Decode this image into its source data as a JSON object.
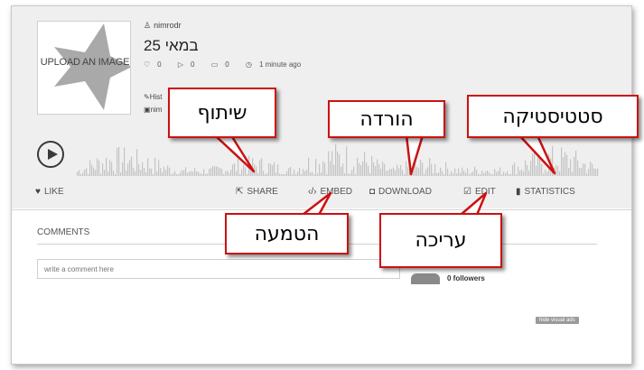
{
  "cover": {
    "label": "UPLOAD AN IMAGE"
  },
  "track": {
    "owner": "nimrodr",
    "owner_icon": "user-icon",
    "title": "25 במאי",
    "stats": {
      "likes": "0",
      "plays": "0",
      "comments": "0",
      "time": "1 minute ago"
    },
    "meta_line1": "Hist",
    "meta_line2": "nim"
  },
  "actions": {
    "like": "LIKE",
    "share": "SHARE",
    "embed": "EMBED",
    "download": "DOWNLOAD",
    "edit": "EDIT",
    "statistics": "STATISTICS"
  },
  "comments": {
    "heading": "COMMENTS",
    "placeholder": "write a comment here"
  },
  "sidebar": {
    "followers": "0 followers",
    "hide_ads": "hide visual ads"
  },
  "callouts": {
    "share": "שיתוף",
    "download": "הורדה",
    "statistics": "סטטיסטיקה",
    "embed": "הטמעה",
    "edit": "עריכה"
  },
  "colors": {
    "callout_border": "#cc1111",
    "hero_background": "#efefef",
    "waveform": "#c4c4c4"
  }
}
